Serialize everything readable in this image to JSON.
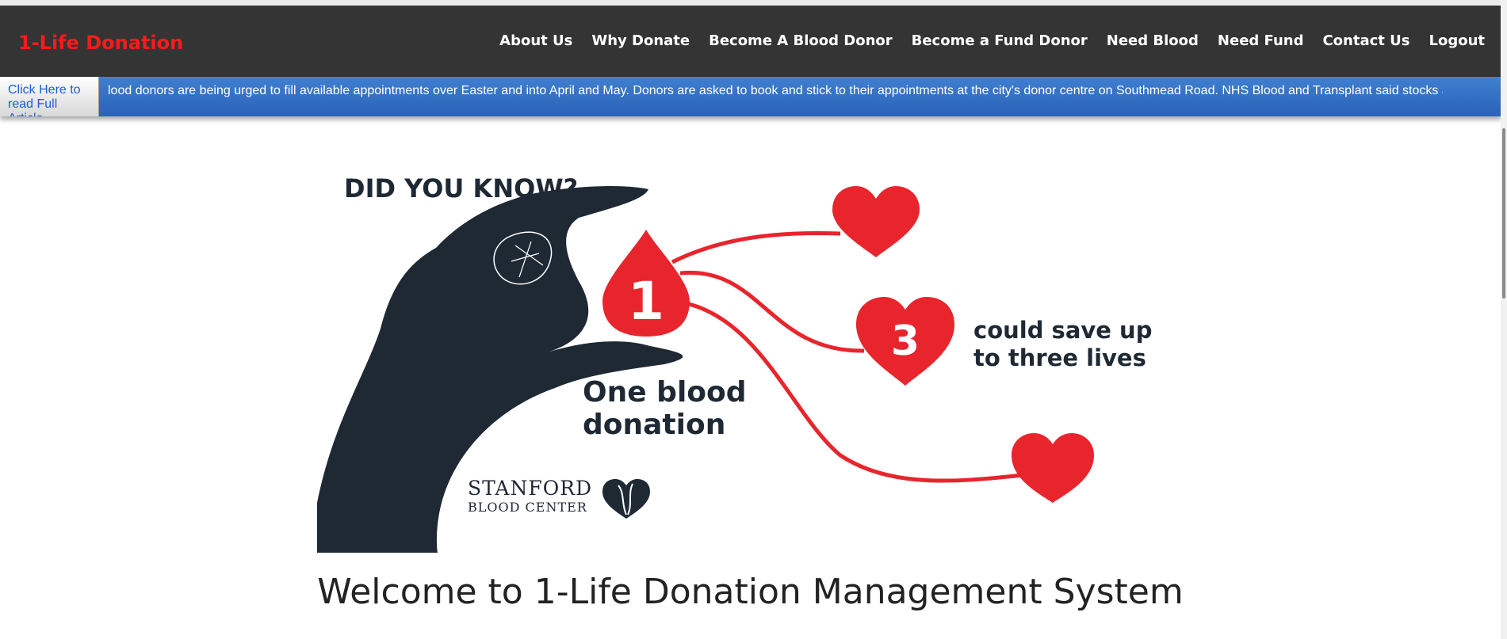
{
  "brand": {
    "name": "1-Life Donation"
  },
  "nav": {
    "items": [
      {
        "label": "About Us"
      },
      {
        "label": "Why Donate"
      },
      {
        "label": "Become A Blood Donor"
      },
      {
        "label": "Become a Fund Donor"
      },
      {
        "label": "Need Blood"
      },
      {
        "label": "Need Fund"
      },
      {
        "label": "Contact Us"
      },
      {
        "label": "Logout"
      }
    ]
  },
  "ticker": {
    "button_label": "Click Here to read Full Article",
    "text": "lood donors are being urged to fill available appointments over Easter and into April and May. Donors are asked to book and stick to their appointments at the city's donor centre on Southmead Road. NHS Blood and Transplant said stocks a"
  },
  "infographic": {
    "headline": "DID YOU KNOW?",
    "drop_number": "1",
    "heart_number": "3",
    "caption_line1": "One blood",
    "caption_line2": "donation",
    "claim_line1": "could save up",
    "claim_line2": "to three lives",
    "logo_line1": "STANFORD",
    "logo_line2": "BLOOD CENTER",
    "colors": {
      "red": "#e8252d",
      "dark": "#1e2934"
    }
  },
  "main": {
    "welcome": "Welcome to 1-Life Donation Management System"
  },
  "colors": {
    "navbar": "#343434",
    "brand": "#ff1a1a",
    "ticker": "#2f6bbf"
  }
}
